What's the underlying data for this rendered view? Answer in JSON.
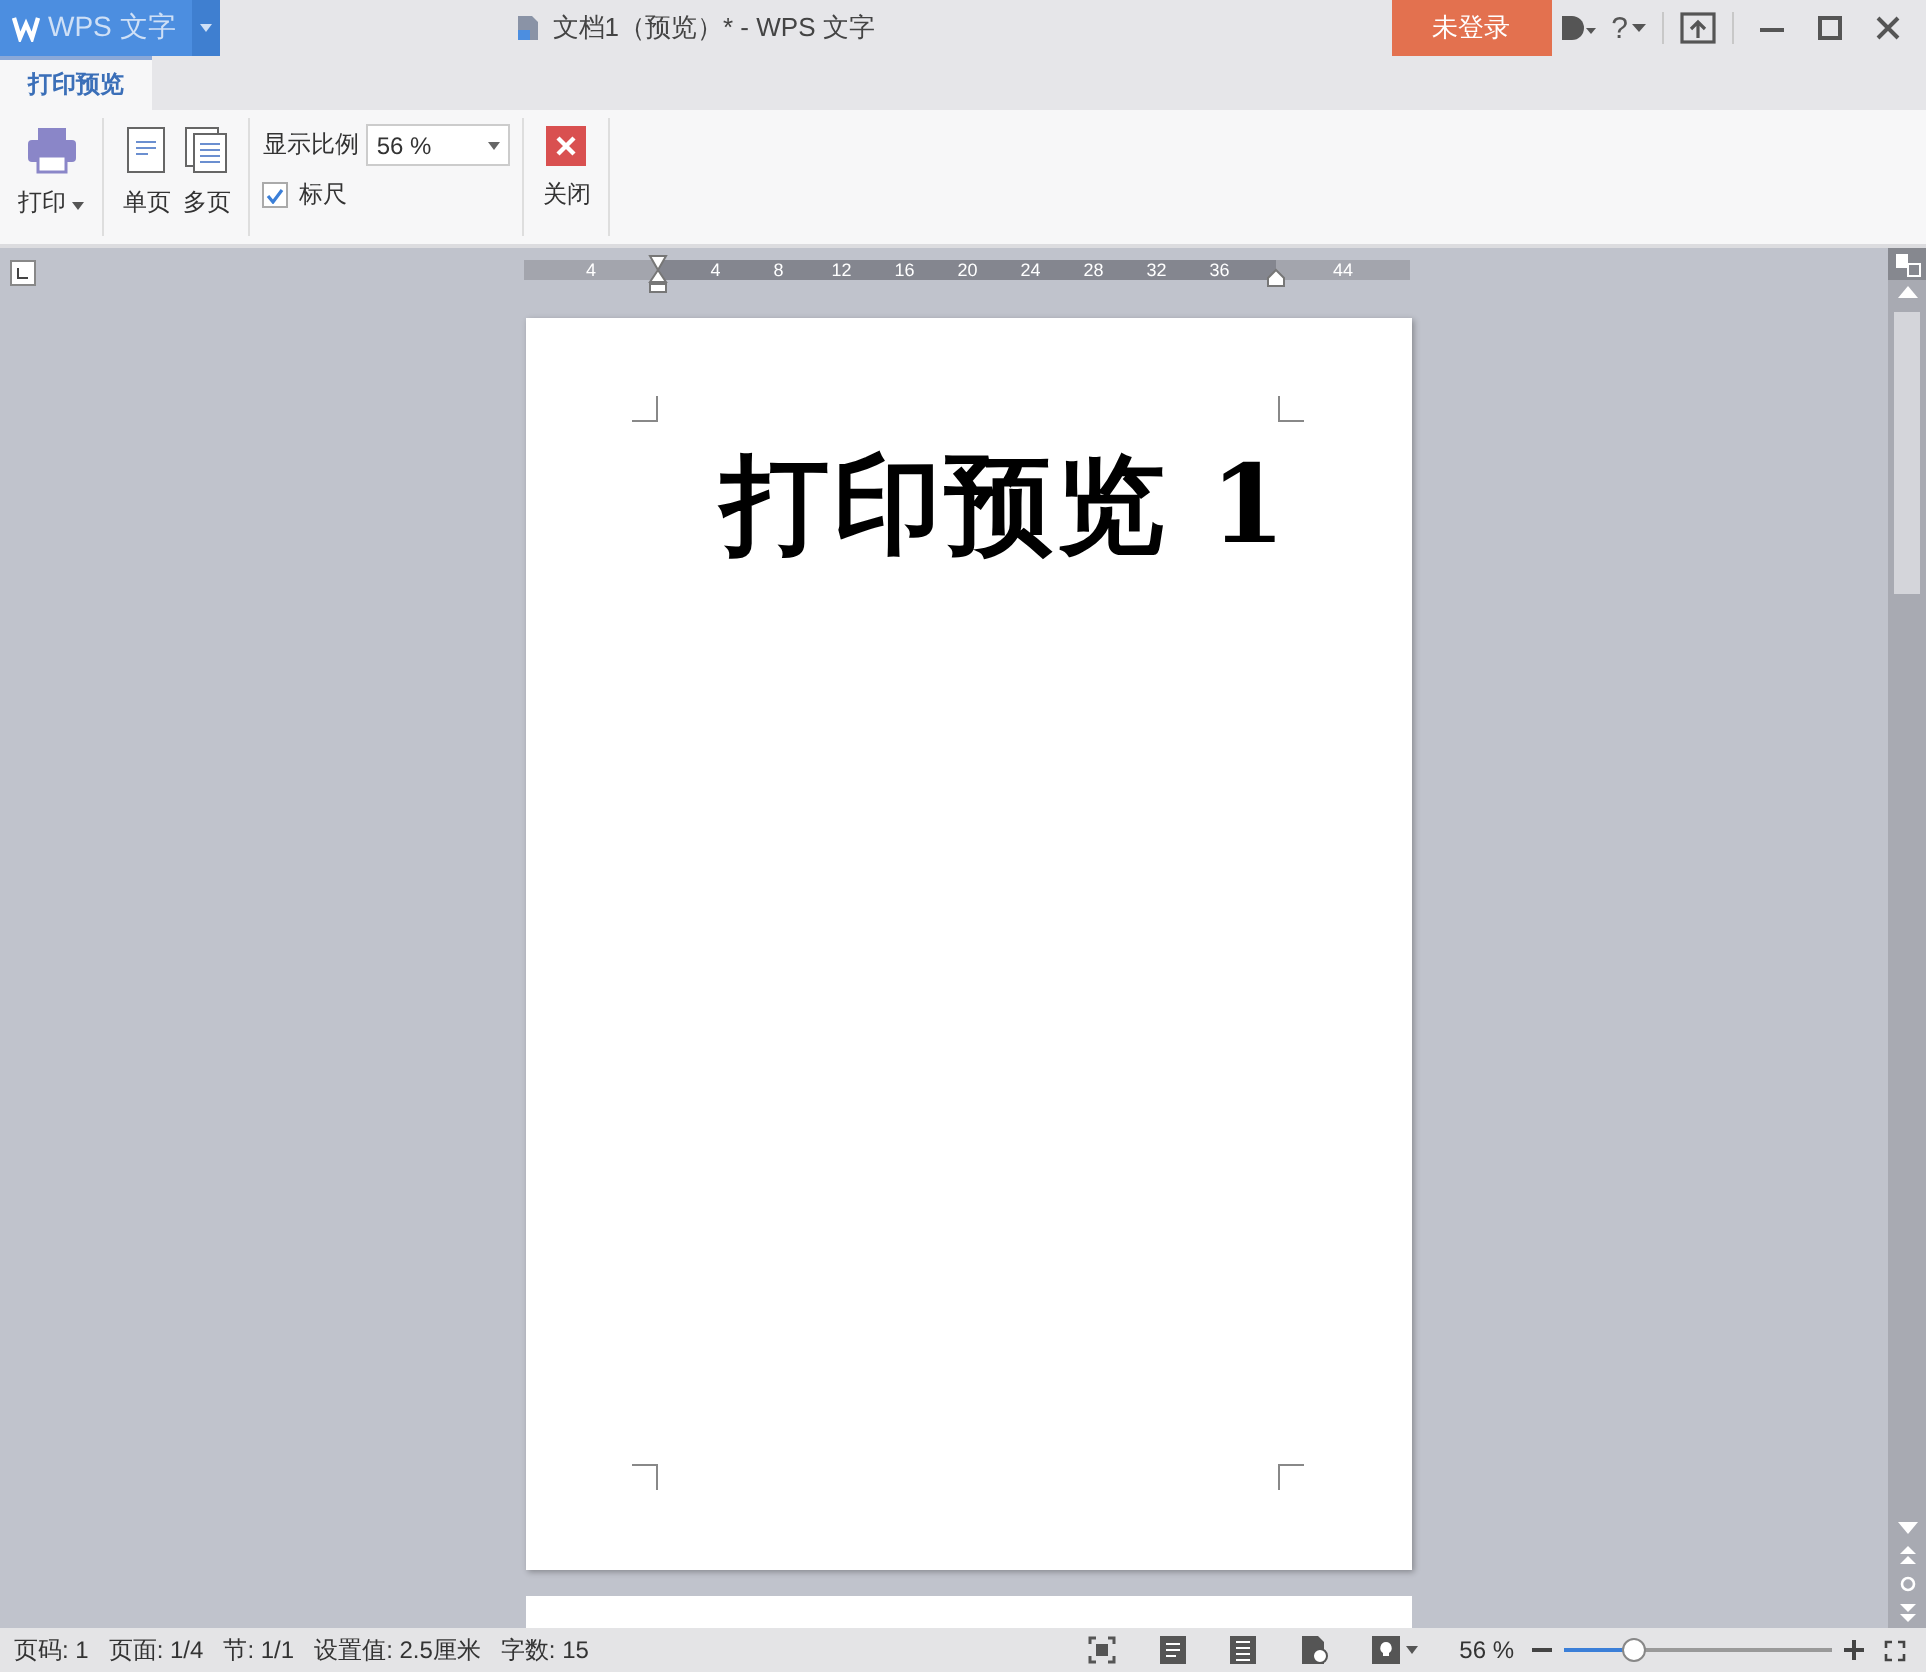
{
  "app_menu": {
    "label": "WPS 文字"
  },
  "window": {
    "title": "文档1（预览）* - WPS 文字"
  },
  "login_button": "未登录",
  "help_button": "?",
  "tabs": [
    {
      "label": "打印预览",
      "selected": true
    }
  ],
  "ribbon": {
    "print": "打印",
    "single_page": "单页",
    "multi_page": "多页",
    "zoom_label": "显示比例",
    "zoom_value": "56 %",
    "ruler_toggle": {
      "label": "标尺",
      "checked": true
    },
    "close": "关闭"
  },
  "ruler": {
    "left_labels": [
      "4"
    ],
    "body_labels": [
      "4",
      "8",
      "12",
      "16",
      "20",
      "24",
      "28",
      "32",
      "36"
    ],
    "right_labels": [
      "44"
    ]
  },
  "document": {
    "heading": "打印预览 1"
  },
  "status_bar": {
    "items": [
      "页码: 1",
      "页面: 1/4",
      "节: 1/1",
      "设置值: 2.5厘米",
      "字数: 15"
    ],
    "zoom": "56 %",
    "zoom_slider": {
      "level": 0.26
    }
  }
}
